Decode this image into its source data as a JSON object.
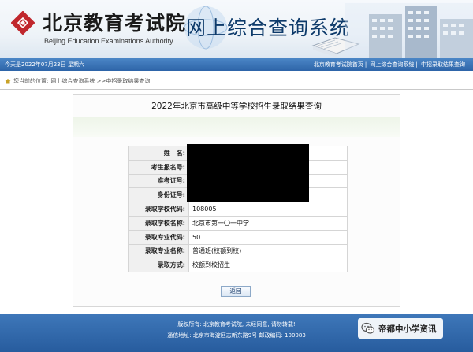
{
  "header": {
    "logo_cn": "北京教育考试院",
    "logo_en": "Beijing Education Examinations Authority",
    "system_title": "网上综合查询系统"
  },
  "navbar": {
    "date": "今天是2022年07月23日  星期六",
    "links": [
      "北京教育考试院首页",
      "网上综合查询系统",
      "中招录取结果查询"
    ]
  },
  "breadcrumb": {
    "prefix": "您当前的位置:",
    "path": "网上综合查询系统 >>中招录取结果查询"
  },
  "main": {
    "title": "2022年北京市高级中等学校招生录取结果查询",
    "rows": [
      {
        "label": "姓　名:",
        "value": ""
      },
      {
        "label": "考生报名号:",
        "value": ""
      },
      {
        "label": "准考证号:",
        "value": ""
      },
      {
        "label": "身份证号:",
        "value": ""
      },
      {
        "label": "录取学校代码:",
        "value": "108005"
      },
      {
        "label": "录取学校名称:",
        "value": "北京市第一〇一中学"
      },
      {
        "label": "录取专业代码:",
        "value": "50"
      },
      {
        "label": "录取专业名称:",
        "value": "普通班(校额到校)"
      },
      {
        "label": "录取方式:",
        "value": "校额到校招生"
      }
    ],
    "back_label": "返回"
  },
  "footer": {
    "line1": "版权所有: 北京教育考试院, 未经同意, 请勿转载!",
    "line2": "通信地址: 北京市海淀区志新东路9号  邮政编码: 100083"
  },
  "watermark": {
    "text": "帝都中小学资讯",
    "icon": "wechat-icon"
  },
  "colors": {
    "nav_blue": "#2d64a8",
    "title_blue": "#0d3a6a",
    "logo_red": "#c0272d"
  }
}
